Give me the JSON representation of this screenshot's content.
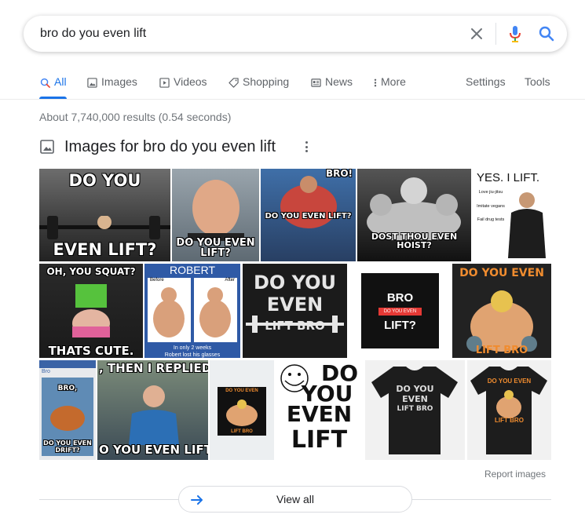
{
  "search": {
    "query": "bro do you even lift"
  },
  "tabs": [
    {
      "label": "All",
      "icon": "search-icon",
      "active": true
    },
    {
      "label": "Images",
      "icon": "image-icon"
    },
    {
      "label": "Videos",
      "icon": "play-icon"
    },
    {
      "label": "Shopping",
      "icon": "tag-icon"
    },
    {
      "label": "News",
      "icon": "news-icon"
    },
    {
      "label": "More",
      "icon": "more-vert-icon"
    }
  ],
  "tools": {
    "settings": "Settings",
    "tools": "Tools"
  },
  "stats": "About 7,740,000 results (0.54 seconds)",
  "images_section": {
    "title": "Images for bro do you even lift",
    "report": "Report images",
    "view_all": "View all",
    "thumbs": [
      {
        "top": "DO YOU",
        "bottom": "EVEN LIFT?"
      },
      {
        "bottom": "DO YOU EVEN LIFT?"
      },
      {
        "top": "BRO!",
        "bottom": "DO YOU EVEN LIFT?"
      },
      {
        "bottom": "DOST THOU EVEN HOIST?"
      },
      {
        "top": "YES. I LIFT.",
        "list": [
          "Love jiu-jitsu",
          "Imitate vegans",
          "Fail drug tests"
        ]
      },
      {
        "top": "OH, YOU SQUAT?",
        "bottom": "THATS CUTE."
      },
      {
        "top": "ROBERT",
        "before": "Before",
        "after": "After",
        "bottom": "In only 2 weeks",
        "bottom2": "Robert lost his glasses"
      },
      {
        "line1": "DO YOU",
        "line2": "EVEN",
        "line3": "LIFT BRO"
      },
      {
        "line1": "BRO",
        "line2": "DO YOU EVEN",
        "line3": "LIFT?"
      },
      {
        "top": "DO YOU EVEN",
        "bottom": "LIFT BRO"
      },
      {
        "top": "Bro",
        "mid": "BRO,",
        "bottom": "DO YOU EVEN DRIFT?"
      },
      {
        "top": ", THEN I REPLIED WI",
        "bottom": "O YOU EVEN LIFT"
      },
      {
        "top": "DO YOU EVEN",
        "bottom": "LIFT BRO"
      },
      {
        "line1": "DO",
        "line2": "YOU",
        "line3": "EVEN",
        "line4": "LIFT"
      },
      {
        "line1": "DO YOU",
        "line2": "EVEN",
        "line3": "LIFT BRO"
      },
      {
        "top": "DO YOU EVEN",
        "bottom": "LIFT BRO"
      }
    ]
  },
  "colors": {
    "accent": "#1a73e8",
    "mic_blue": "#4285f4",
    "mic_red": "#ea4335",
    "mic_yellow": "#fbbc04",
    "mic_green": "#34a853"
  }
}
